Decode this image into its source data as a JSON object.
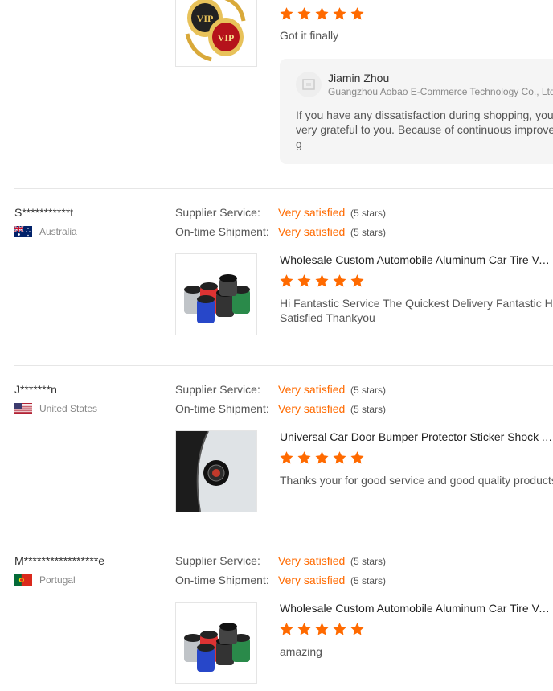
{
  "colors": {
    "accent": "#ff6a00",
    "star": "#ff6a00",
    "divider": "#e6e6e6",
    "reply_bg": "#f5f5f5"
  },
  "reviews": [
    {
      "image_icon": "vip-badges-image",
      "rating": 5,
      "text": "Got it finally",
      "reply": {
        "name": "Jiamin Zhou",
        "company": "Guangzhou Aobao E-Commerce Technology Co., Ltd.",
        "line1": "If you have any dissatisfaction during shopping, you c",
        "line2": "very grateful to you. Because of continuous improven",
        "line3": "g"
      }
    },
    {
      "username": "S***********t",
      "country": "Australia",
      "flag_icon": "australia-flag-icon",
      "supplier_label": "Supplier Service:",
      "supplier_value": "Very satisfied",
      "supplier_stars": "(5 stars)",
      "shipment_label": "On-time Shipment:",
      "shipment_value": "Very satisfied",
      "shipment_stars": "(5 stars)",
      "product": "Wholesale Custom Automobile Aluminum Car Tire Valve Caps",
      "image_icon": "valve-caps-image",
      "rating": 5,
      "line1": "Hi Fantastic Service The Quickest Delivery Fantastic Help",
      "line2": "Satisfied Thankyou"
    },
    {
      "username": "J*******n",
      "country": "United States",
      "flag_icon": "usa-flag-icon",
      "supplier_label": "Supplier Service:",
      "supplier_value": "Very satisfied",
      "supplier_stars": "(5 stars)",
      "shipment_label": "On-time Shipment:",
      "shipment_value": "Very satisfied",
      "shipment_stars": "(5 stars)",
      "product": "Universal Car Door Bumper Protector Sticker Shock Absorber",
      "image_icon": "door-bumper-image",
      "rating": 5,
      "line1": "Thanks your for good service and good quality products"
    },
    {
      "username": "M*****************e",
      "country": "Portugal",
      "flag_icon": "portugal-flag-icon",
      "supplier_label": "Supplier Service:",
      "supplier_value": "Very satisfied",
      "supplier_stars": "(5 stars)",
      "shipment_label": "On-time Shipment:",
      "shipment_value": "Very satisfied",
      "shipment_stars": "(5 stars)",
      "product": "Wholesale Custom Automobile Aluminum Car Tire Valve Caps",
      "image_icon": "valve-caps-image",
      "rating": 5,
      "line1": "amazing"
    }
  ]
}
